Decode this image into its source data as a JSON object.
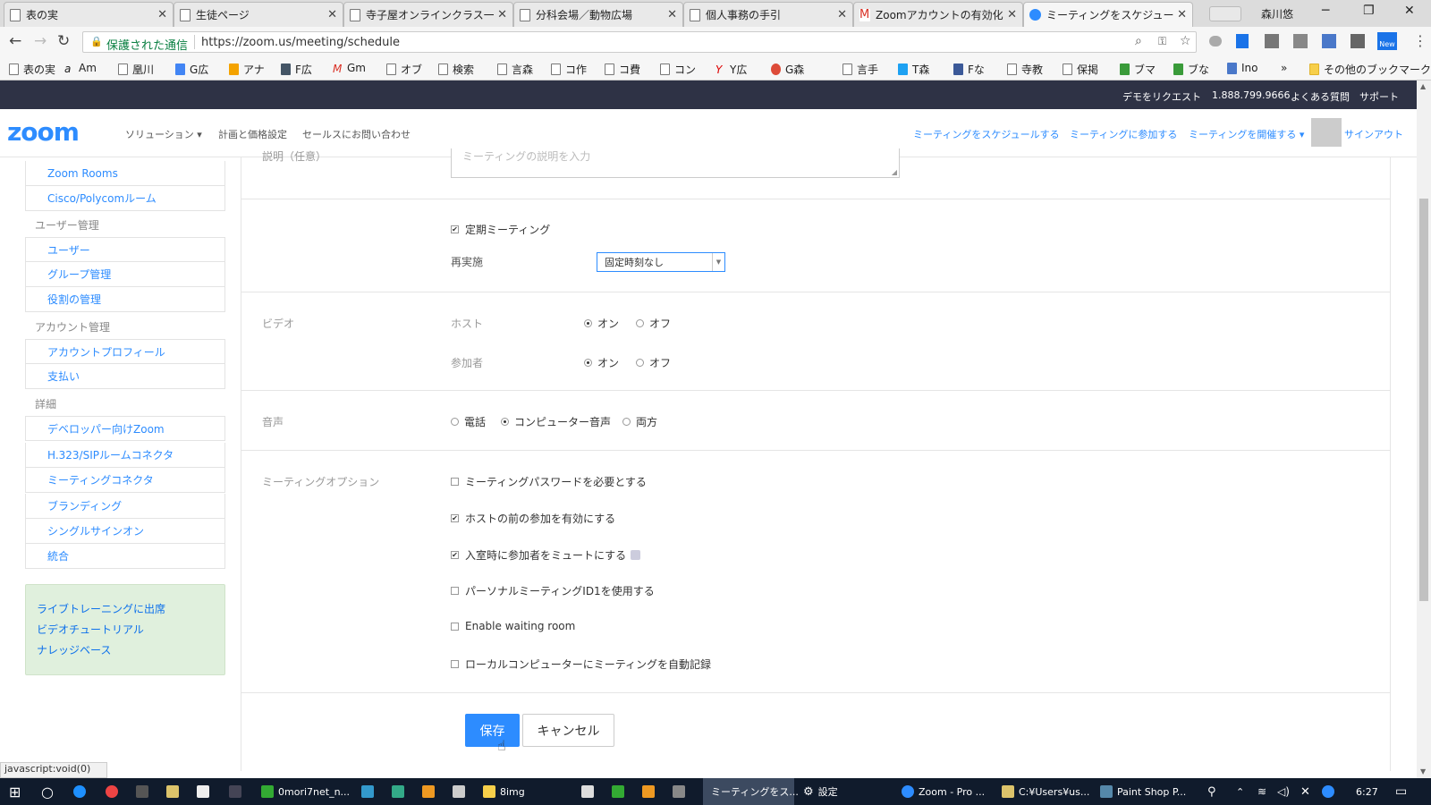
{
  "browser": {
    "tabs": [
      {
        "label": "表の実",
        "active": false
      },
      {
        "label": "生徒ページ",
        "active": false
      },
      {
        "label": "寺子屋オンラインクラス一覧",
        "active": false
      },
      {
        "label": "分科会場／動物広場",
        "active": false
      },
      {
        "label": "個人事務の手引",
        "active": false
      },
      {
        "label": "Zoomアカウントの有効化 -",
        "active": false
      },
      {
        "label": "ミーティングをスケジュールする",
        "active": true
      }
    ],
    "profile_name": "森川悠",
    "secure_label": "保護された通信",
    "url": "https://zoom.us/meeting/schedule",
    "bookmarks": [
      "表の実",
      "Am",
      "凰川",
      "G広",
      "アナ",
      "F広",
      "Gm",
      "オブ",
      "検索",
      "言森",
      "コ作",
      "コ費",
      "コン",
      "Y広",
      "G森",
      "言手",
      "T森",
      "Fな",
      "寺教",
      "保掲",
      "ブマ",
      "ブな",
      "Ino"
    ],
    "other_bookmarks": "その他のブックマーク",
    "status_text": "javascript:void(0)"
  },
  "zoom": {
    "topbar": {
      "demo": "デモをリクエスト",
      "phone": "1.888.799.9666",
      "faq": "よくある質問",
      "support": "サポート"
    },
    "logo": "zoom",
    "nav": {
      "solutions": "ソリューション",
      "pricing": "計画と価格設定",
      "contact": "セールスにお問い合わせ"
    },
    "nav_right": {
      "schedule": "ミーティングをスケジュールする",
      "join": "ミーティングに参加する",
      "host": "ミーティングを開催する",
      "signout": "サインアウト"
    }
  },
  "sidebar": {
    "items": [
      {
        "label": "Zoom Rooms",
        "type": "sub"
      },
      {
        "label": "Cisco/Polycomルーム",
        "type": "sub"
      },
      {
        "label": "ユーザー管理",
        "type": "header"
      },
      {
        "label": "ユーザー",
        "type": "sub"
      },
      {
        "label": "グループ管理",
        "type": "sub"
      },
      {
        "label": "役割の管理",
        "type": "sub"
      },
      {
        "label": "アカウント管理",
        "type": "header"
      },
      {
        "label": "アカウントプロフィール",
        "type": "sub"
      },
      {
        "label": "支払い",
        "type": "sub"
      },
      {
        "label": "詳細",
        "type": "header"
      },
      {
        "label": "デベロッパー向けZoom",
        "type": "sub"
      },
      {
        "label": "H.323/SIPルームコネクタ",
        "type": "sub"
      },
      {
        "label": "ミーティングコネクタ",
        "type": "sub"
      },
      {
        "label": "ブランディング",
        "type": "sub"
      },
      {
        "label": "シングルサインオン",
        "type": "sub"
      },
      {
        "label": "統合",
        "type": "sub"
      }
    ],
    "links": [
      "ライブトレーニングに出席",
      "ビデオチュートリアル",
      "ナレッジベース"
    ]
  },
  "form": {
    "description_label": "説明（任意）",
    "description_placeholder": "ミーティングの説明を入力",
    "recurring_label": "定期ミーティング",
    "recurring_checked": true,
    "recurrence_label": "再実施",
    "recurrence_value": "固定時刻なし",
    "video_label": "ビデオ",
    "host_label": "ホスト",
    "participants_label": "参加者",
    "on": "オン",
    "off": "オフ",
    "host_video": "on",
    "participant_video": "on",
    "audio_label": "音声",
    "audio_options": [
      "電話",
      "コンピューター音声",
      "両方"
    ],
    "audio_selected": "コンピューター音声",
    "options_label": "ミーティングオプション",
    "options": [
      {
        "label": "ミーティングパスワードを必要とする",
        "checked": false
      },
      {
        "label": "ホストの前の参加を有効にする",
        "checked": true
      },
      {
        "label": "入室時に参加者をミュートにする",
        "checked": true
      },
      {
        "label": "パーソナルミーティングID1を使用する",
        "checked": false
      },
      {
        "label": "Enable waiting room",
        "checked": false
      },
      {
        "label": "ローカルコンピューターにミーティングを自動記録",
        "checked": false
      }
    ],
    "save": "保存",
    "cancel": "キャンセル"
  },
  "taskbar": {
    "items": [
      "0mori7net_n...",
      "8img",
      "ミーティングをス...",
      "設定",
      "Zoom - Pro ...",
      "C:¥Users¥us...",
      "Paint Shop P..."
    ],
    "time": "6:27"
  },
  "colors": {
    "accent": "#2d8cff",
    "topbar": "#2e3245",
    "taskbar": "#101b2c"
  }
}
